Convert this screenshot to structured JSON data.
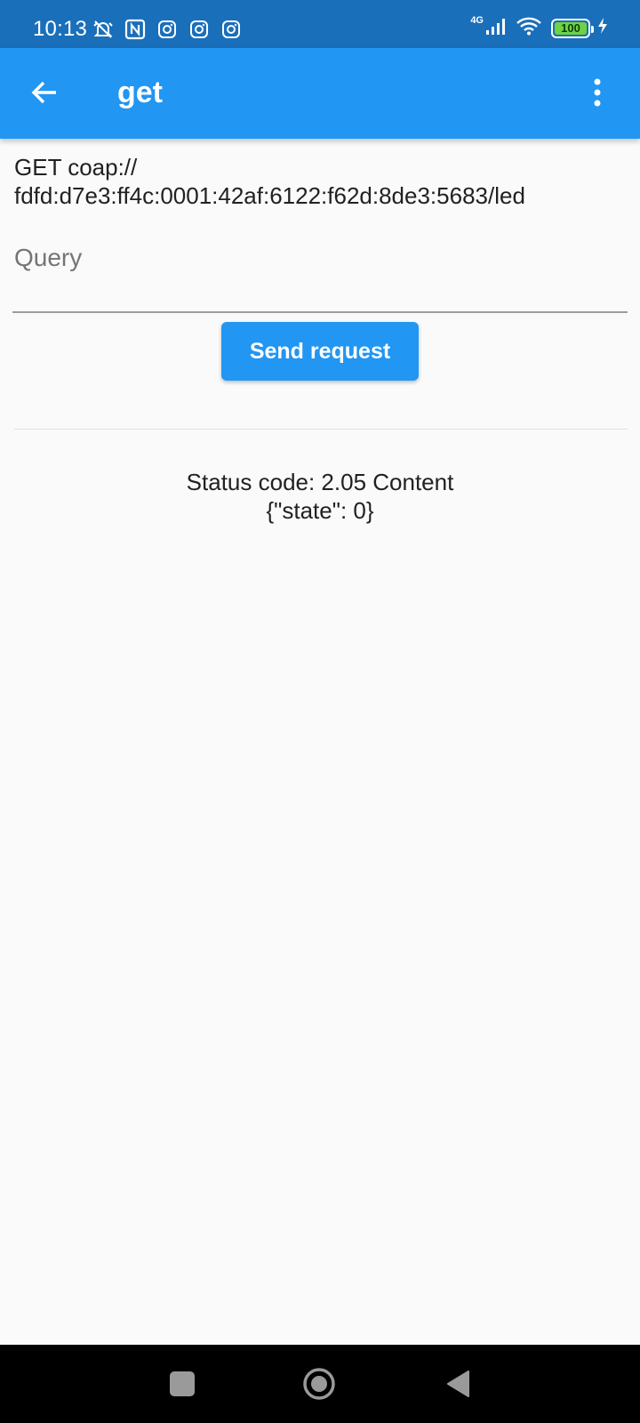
{
  "status_bar": {
    "time": "10:13",
    "left_icons": [
      "alarm-off-icon",
      "nfc-icon",
      "instagram-icon",
      "instagram-icon",
      "instagram-icon"
    ],
    "network_label": "4G",
    "battery_level": "100",
    "colors": {
      "background": "#1a6fba",
      "battery_fill": "#6fd241"
    }
  },
  "app_bar": {
    "title": "get",
    "back_icon": "arrow-back-icon",
    "menu_icon": "more-vert-icon",
    "color": "#2196f3"
  },
  "request": {
    "line1": "GET coap://",
    "line2": "fdfd:d7e3:ff4c:0001:42af:6122:f62d:8de3:5683/led"
  },
  "query": {
    "placeholder": "Query",
    "value": ""
  },
  "send_button": {
    "label": "Send request",
    "color": "#2196f3"
  },
  "response": {
    "status_line": "Status code: 2.05 Content",
    "payload": "{\"state\": 0}"
  },
  "nav_bar": {
    "recents_icon": "square-recents-icon",
    "home_icon": "circle-home-icon",
    "back_icon": "triangle-back-icon"
  }
}
